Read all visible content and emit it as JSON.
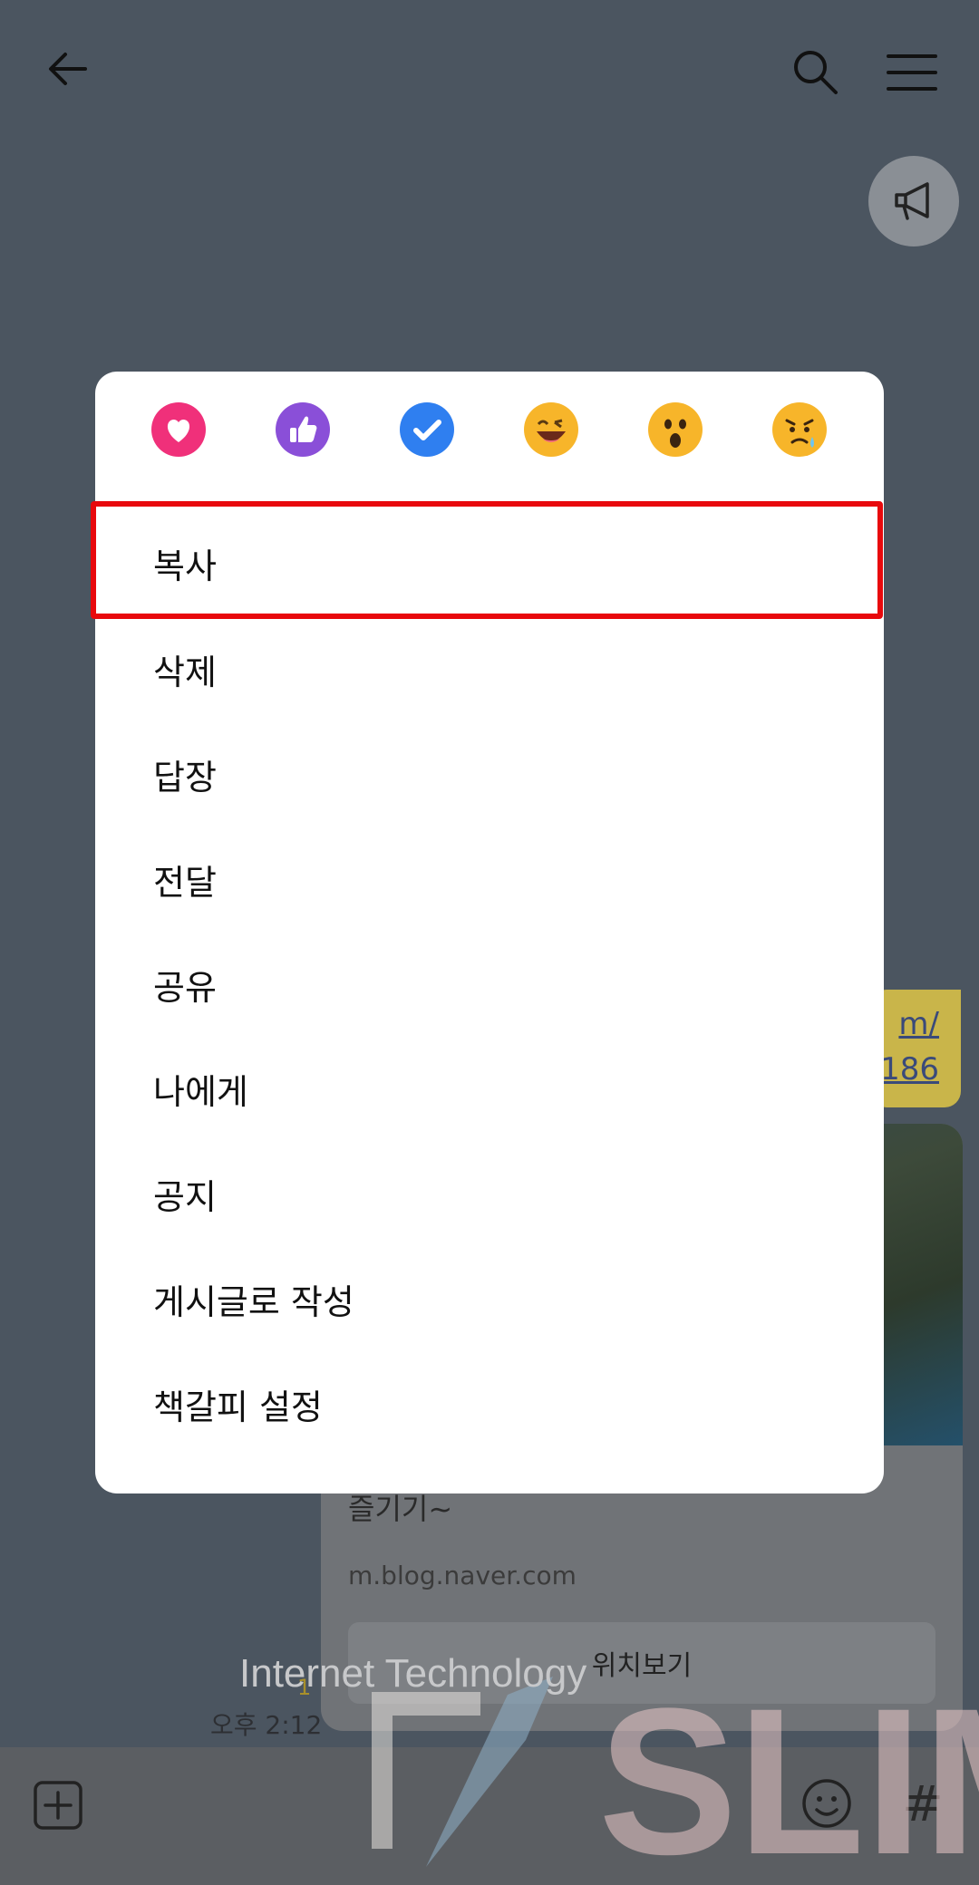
{
  "header": {
    "back_icon": "arrow-left-icon",
    "search_icon": "search-icon",
    "menu_icon": "hamburger-menu-icon",
    "announce_icon": "megaphone-icon"
  },
  "background_chat": {
    "link_line1": "m/",
    "link_line2": "186",
    "card": {
      "title": "즐기기~",
      "domain": "m.blog.naver.com",
      "button_label": "위치보기"
    },
    "unread_count": "1",
    "time": "오후 2:12"
  },
  "reactions": [
    {
      "name": "heart",
      "color": "#f0307a"
    },
    {
      "name": "thumbs-up",
      "color": "#8a4fd8"
    },
    {
      "name": "check",
      "color": "#2f7ff0"
    },
    {
      "name": "laughing-face",
      "color": "#f7b52a"
    },
    {
      "name": "surprised-face",
      "color": "#f7b52a"
    },
    {
      "name": "sad-face",
      "color": "#f7b52a"
    }
  ],
  "menu": {
    "items": [
      "복사",
      "삭제",
      "답장",
      "전달",
      "공유",
      "나에게",
      "공지",
      "게시글로 작성",
      "책갈피 설정"
    ],
    "highlighted_index": 0,
    "highlight_color": "#e8090d"
  },
  "bottom": {
    "plus_icon": "plus-square-icon",
    "emoji_icon": "emoji-icon",
    "hash_label": "#"
  },
  "watermark": {
    "text": "Internet Technology",
    "brand": "SLIM"
  }
}
